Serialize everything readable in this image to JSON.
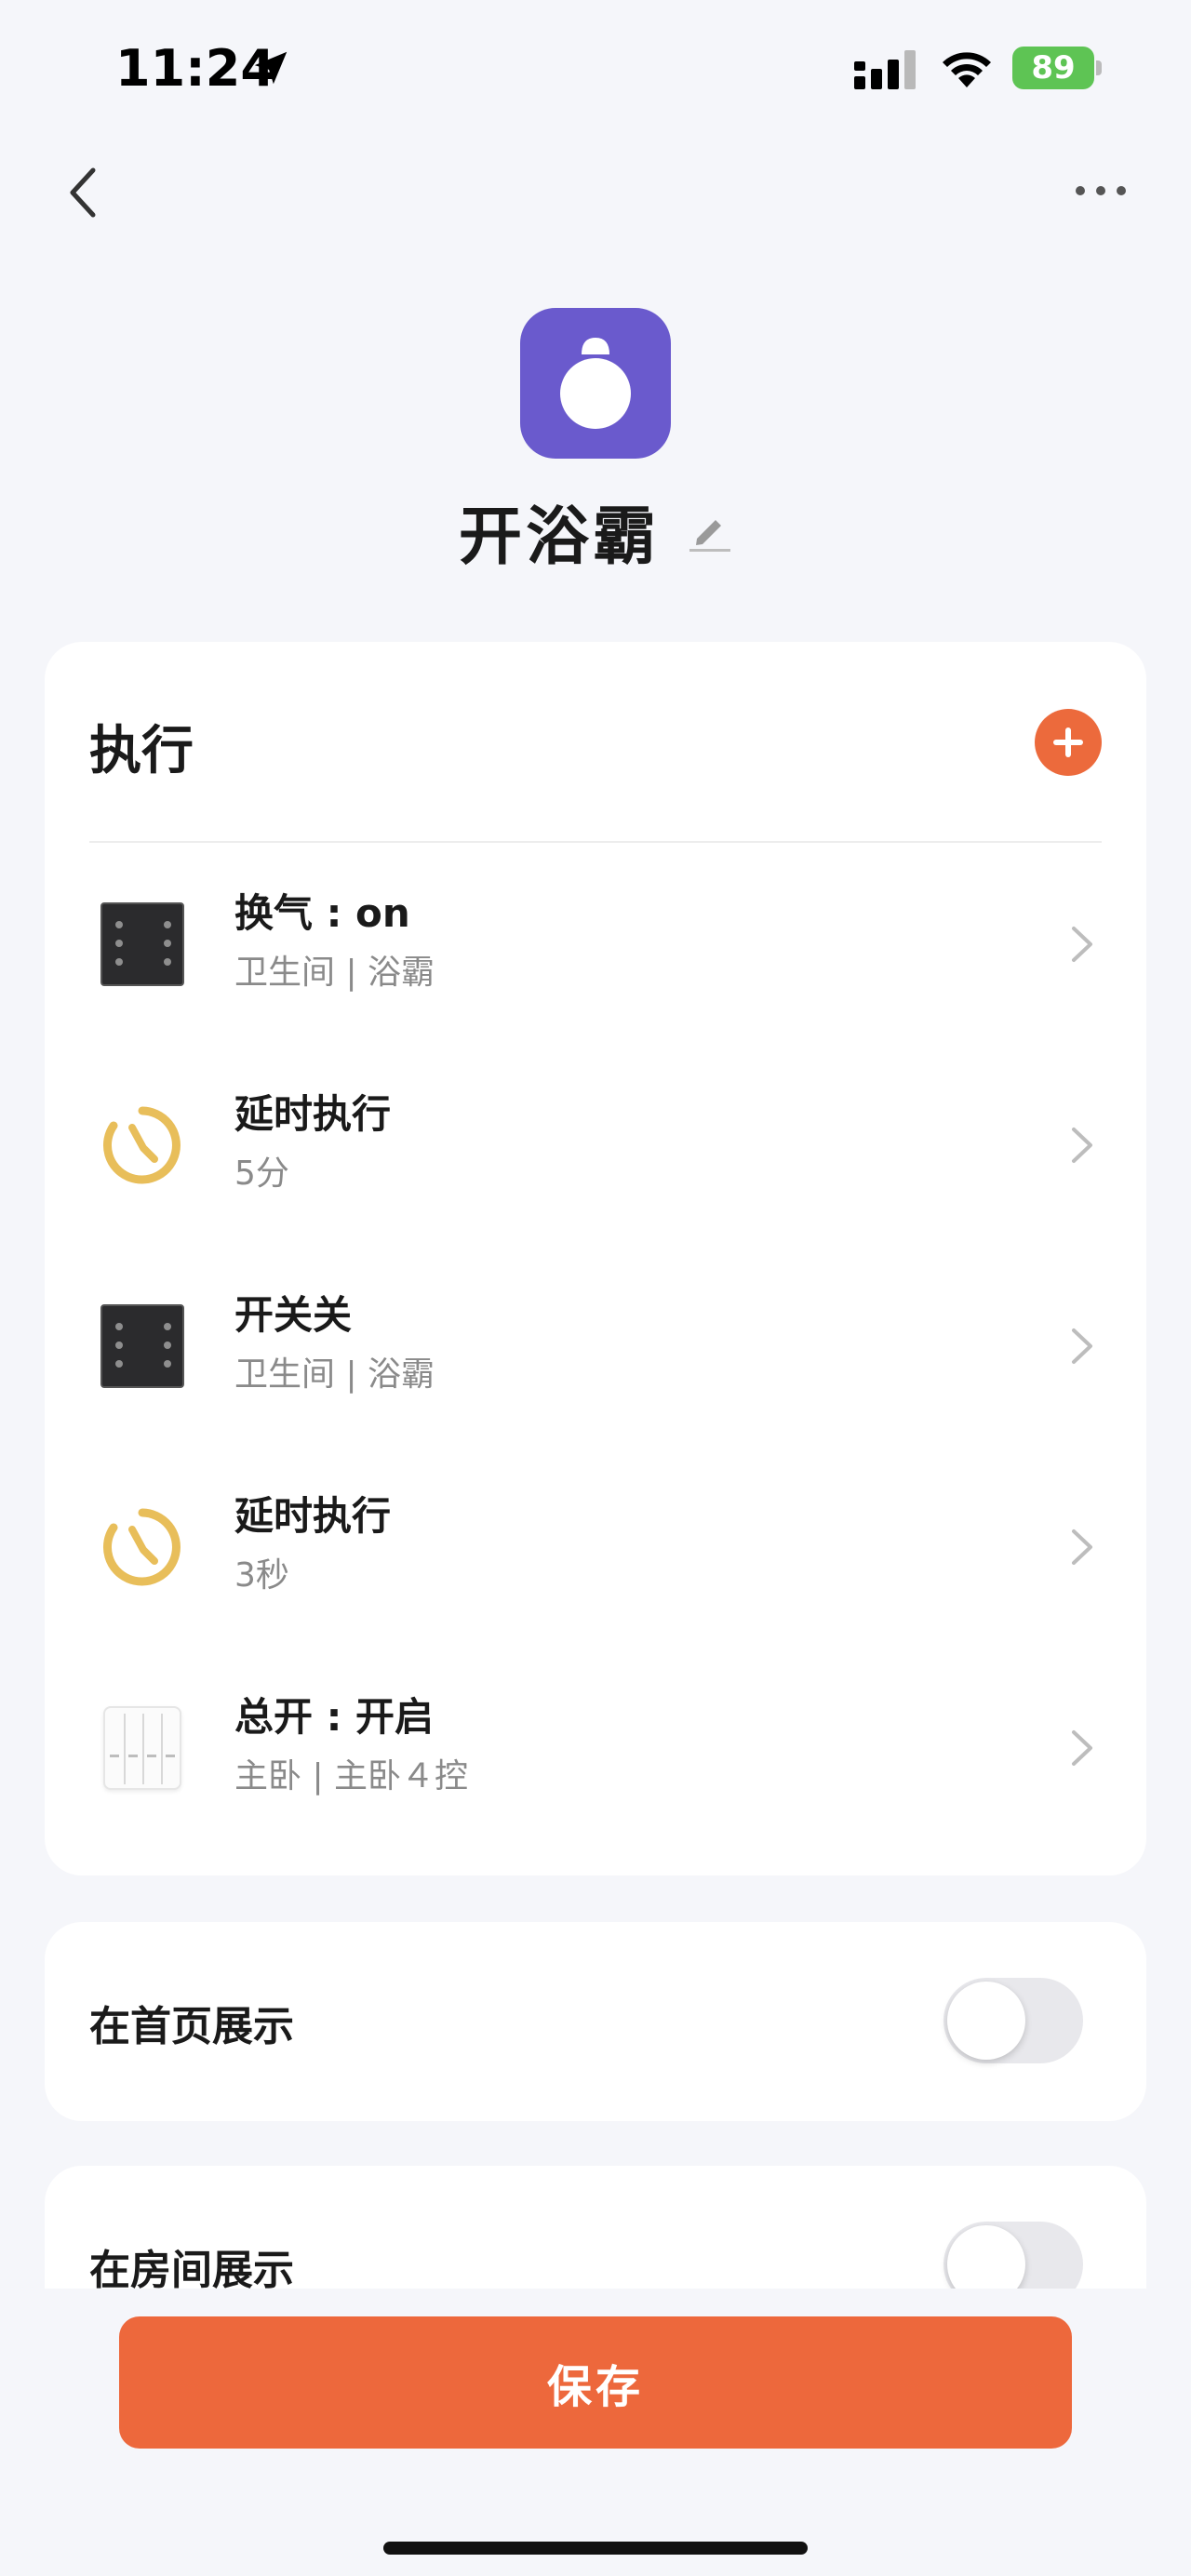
{
  "status_bar": {
    "time": "11:24",
    "battery": "89"
  },
  "nav": {
    "back_icon": "chevron-left-icon",
    "more_icon": "more-dots-icon"
  },
  "scene": {
    "title": "开浴霸",
    "icon": "bath-heater-icon",
    "icon_color": "#6a5acd"
  },
  "execute": {
    "title": "执行",
    "accent": "#ec6a3c",
    "items": [
      {
        "name": "换气 : on",
        "sub": "卫生间 | 浴霸",
        "icon": "panel-switch"
      },
      {
        "name": "延时执行",
        "sub": "5分",
        "icon": "timer-icon"
      },
      {
        "name": "开关关",
        "sub": "卫生间 | 浴霸",
        "icon": "panel-switch"
      },
      {
        "name": "延时执行",
        "sub": "3秒",
        "icon": "timer-icon"
      },
      {
        "name": "总开 : 开启",
        "sub": "主卧 | 主卧４控",
        "icon": "wall-switch-4"
      }
    ]
  },
  "toggles": {
    "home": {
      "label": "在首页展示",
      "on": false
    },
    "room": {
      "label": "在房间展示",
      "on": false
    }
  },
  "save": {
    "label": "保存"
  }
}
